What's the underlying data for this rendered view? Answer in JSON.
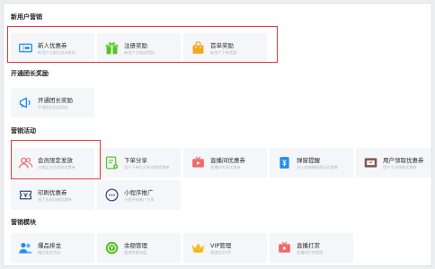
{
  "sections": [
    {
      "title": "新用户营销",
      "cards": [
        {
          "name": "新人优惠券",
          "desc": "新用户注册后自动发放",
          "icon": "ticket-icon"
        },
        {
          "name": "注册奖励",
          "desc": "新用户注册送奖励",
          "icon": "gift-icon"
        },
        {
          "name": "首单奖励",
          "desc": "新用户下单奖励",
          "icon": "shopping-bag-icon"
        }
      ]
    },
    {
      "title": "开通团长奖励",
      "cards": [
        {
          "name": "开通团长奖励",
          "desc": "开通团长后送奖励",
          "icon": "megaphone-icon"
        }
      ]
    },
    {
      "title": "营销活动",
      "cards": [
        {
          "name": "会员限定发放",
          "desc": "对指定会员发放优惠券",
          "icon": "users-icon"
        },
        {
          "name": "下单分享",
          "desc": "用户下单后分享领取优惠券",
          "icon": "share-doc-icon"
        },
        {
          "name": "直播间优惠券",
          "desc": "直播间专享优惠券",
          "icon": "live-tv-icon"
        },
        {
          "name": "弹窗提醒",
          "desc": "进入商城弹窗提示优惠券",
          "icon": "yuan-tag-icon"
        },
        {
          "name": "用户领取优惠券",
          "desc": "用户主动领取优惠券",
          "icon": "coupon-box-icon"
        },
        {
          "name": "印刷优惠券",
          "desc": "线下发放印刷优惠券",
          "icon": "print-ticket-icon"
        },
        {
          "name": "小程序推广",
          "desc": "小程序码推广分享",
          "icon": "chat-bubble-icon"
        }
      ]
    },
    {
      "title": "营销模块",
      "cards": [
        {
          "name": "爆品排龙",
          "desc": "爆品接龙活动",
          "icon": "users-icon"
        },
        {
          "name": "余额管理",
          "desc": "管理余额充值",
          "icon": "coin-icon"
        },
        {
          "name": "VIP管理",
          "desc": "管理会员VIP",
          "icon": "crown-icon"
        },
        {
          "name": "直播打赏",
          "desc": "直播间打赏管理",
          "icon": "live-tv-icon"
        }
      ]
    }
  ],
  "colors": {
    "highlight": "#e8363a",
    "blue": "#1f8cf0",
    "green": "#58c22a",
    "orange": "#f5a623",
    "pink": "#f06b6b",
    "yellow": "#f2c21b"
  }
}
